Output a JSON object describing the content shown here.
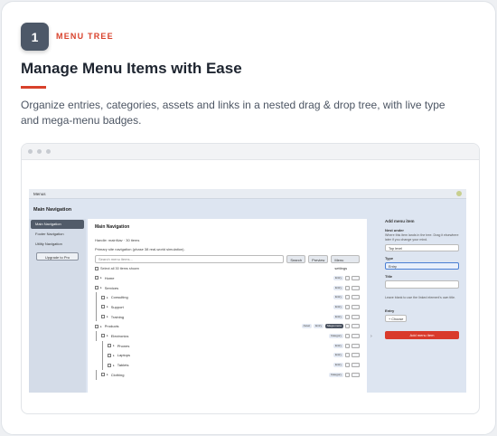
{
  "step": {
    "number": "1",
    "label": "MENU TREE"
  },
  "headline": "Manage Menu Items with Ease",
  "description": "Organize entries, categories, assets and links in a nested drag & drop tree, with live type and mega-menu badges.",
  "colors": {
    "accent": "#d8412b",
    "badge": "#4d5868"
  },
  "app": {
    "topbar_title": "Menus",
    "page_title": "Main Navigation",
    "sidebar": {
      "items": [
        "Main Navigation",
        "Footer Navigation",
        "Utility Navigation"
      ],
      "upgrade_label": "Upgrade to Pro"
    },
    "panel": {
      "title": "Main Navigation",
      "handle": "Handle: mainNav · 30 items",
      "subtitle": "Primary site navigation (phase 38 real-world simulation).",
      "search_placeholder": "Search menu items...",
      "buttons": [
        "Search",
        "Preview",
        "Menu settings"
      ],
      "select_all": "Select all 30 items shown"
    },
    "tree": [
      {
        "name": "Home",
        "badges": [
          "Entry"
        ],
        "depth": 0
      },
      {
        "name": "Services",
        "badges": [
          "Entry"
        ],
        "depth": 0
      },
      {
        "name": "Consulting",
        "badges": [
          "Entry"
        ],
        "depth": 1
      },
      {
        "name": "Support",
        "badges": [
          "Entry"
        ],
        "depth": 1
      },
      {
        "name": "Training",
        "badges": [
          "Entry"
        ],
        "depth": 1
      },
      {
        "name": "Products",
        "badges": [
          "Asset",
          "Entry",
          "Mega menu"
        ],
        "depth": 0
      },
      {
        "name": "Electronics",
        "badges": [
          "Category"
        ],
        "depth": 1
      },
      {
        "name": "Phones",
        "badges": [
          "Entry"
        ],
        "depth": 2
      },
      {
        "name": "Laptops",
        "badges": [
          "Entry"
        ],
        "depth": 2
      },
      {
        "name": "Tablets",
        "badges": [
          "Entry"
        ],
        "depth": 2
      },
      {
        "name": "Clothing",
        "badges": [
          "Category"
        ],
        "depth": 1
      }
    ],
    "add_panel": {
      "title": "Add menu item",
      "nest_label": "Nest under",
      "nest_help": "Where this item lands in the tree. Drag it elsewhere later if you change your mind.",
      "nest_value": "Top level",
      "type_label": "Type",
      "type_value": "Entry",
      "title_label": "Title",
      "title_help": "Leave blank to use the linked element's own title.",
      "entry_label": "Entry",
      "choose_label": "+ Choose",
      "add_button": "Add menu item"
    }
  }
}
